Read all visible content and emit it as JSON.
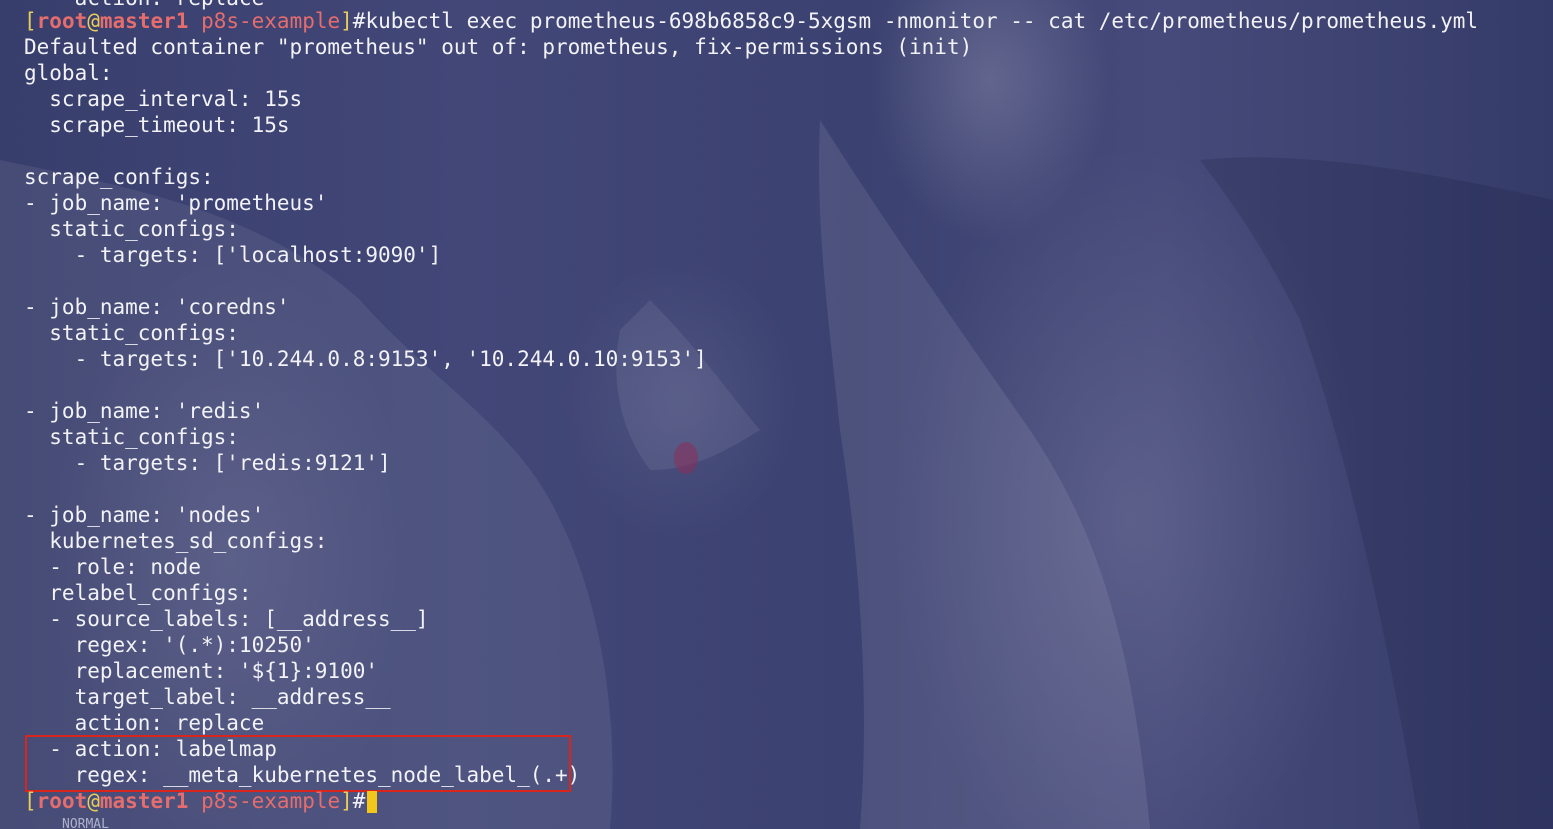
{
  "terminal": {
    "prompt": {
      "open_bracket": "[",
      "user": "root",
      "at": "@",
      "host": "master1",
      "space": " ",
      "cwd": "p8s-example",
      "close_bracket": "]",
      "symbol": "#"
    },
    "command": "kubectl exec prometheus-698b6858c9-5xgsm -nmonitor -- cat /etc/prometheus/prometheus.yml",
    "partial_top_line": "    action: replace",
    "output_lines": [
      "Defaulted container \"prometheus\" out of: prometheus, fix-permissions (init)",
      "global:",
      "  scrape_interval: 15s",
      "  scrape_timeout: 15s",
      "",
      "scrape_configs:",
      "- job_name: 'prometheus'",
      "  static_configs:",
      "    - targets: ['localhost:9090']",
      "",
      "- job_name: 'coredns'",
      "  static_configs:",
      "    - targets: ['10.244.0.8:9153', '10.244.0.10:9153']",
      "",
      "- job_name: 'redis'",
      "  static_configs:",
      "    - targets: ['redis:9121']",
      "",
      "- job_name: 'nodes'",
      "  kubernetes_sd_configs:",
      "  - role: node",
      "  relabel_configs:",
      "  - source_labels: [__address__]",
      "    regex: '(.*):10250'",
      "    replacement: '${1}:9100'",
      "    target_label: __address__",
      "    action: replace",
      "  - action: labelmap",
      "    regex: __meta_kubernetes_node_label_(.+)"
    ]
  },
  "status_bar": {
    "mode": "NORMAL"
  },
  "colors": {
    "prompt_bracket": "#e8cd5a",
    "prompt_user_host": "#e56d6d",
    "cursor": "#f3c61a",
    "highlight_box": "#d9251c",
    "text": "#f2f2f7"
  }
}
